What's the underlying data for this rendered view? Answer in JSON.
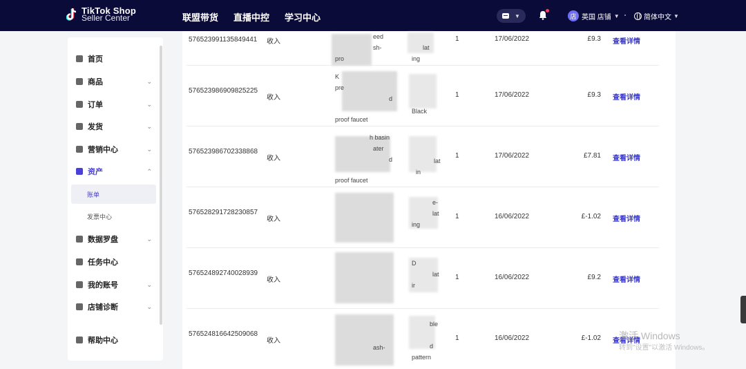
{
  "header": {
    "logo_line1": "TikTok Shop",
    "logo_line2": "Seller Center",
    "nav": [
      "联盟带货",
      "直播中控",
      "学习中心"
    ],
    "account_label": "英国 店铺",
    "account_avatar": "店",
    "language": "简体中文"
  },
  "sidebar": {
    "items": [
      {
        "label": "首页",
        "icon": "home-icon"
      },
      {
        "label": "商品",
        "icon": "product-icon"
      },
      {
        "label": "订单",
        "icon": "order-icon"
      },
      {
        "label": "发货",
        "icon": "truck-icon"
      },
      {
        "label": "营销中心",
        "icon": "megaphone-icon"
      },
      {
        "label": "资产",
        "icon": "wallet-icon"
      },
      {
        "label": "数据罗盘",
        "icon": "chart-icon"
      },
      {
        "label": "任务中心",
        "icon": "medal-icon"
      },
      {
        "label": "我的账号",
        "icon": "user-icon"
      },
      {
        "label": "店铺诊断",
        "icon": "trophy-icon"
      },
      {
        "label": "帮助中心",
        "icon": "help-icon"
      }
    ],
    "sub_items": [
      "账单",
      "发票中心"
    ]
  },
  "table": {
    "rows": [
      {
        "id": "57652399113584944 1",
        "id_display": "57652399113584944​1",
        "type": "收入",
        "product": [
          "eed",
          "sh-",
          "pro"
        ],
        "variant": [
          "lat",
          "ing"
        ],
        "qty": "1",
        "date": "17/06/2022",
        "amount": "£9.3",
        "action": "查看详情"
      },
      {
        "id": "576523986909825225",
        "type": "收入",
        "product": [
          "K",
          "pre",
          "d",
          "proof faucet"
        ],
        "variant": [
          "Black"
        ],
        "qty": "1",
        "date": "17/06/2022",
        "amount": "£9.3",
        "action": "查看详情"
      },
      {
        "id": "576523986702338868",
        "type": "收入",
        "product": [
          "h basin",
          "ater",
          "d",
          "proof faucet"
        ],
        "variant": [
          "lat",
          "in"
        ],
        "qty": "1",
        "date": "17/06/2022",
        "amount": "£7.81",
        "action": "查看详情"
      },
      {
        "id": "576528291728230857",
        "type": "收入",
        "product": [],
        "variant": [
          "e-",
          "lat",
          "ing"
        ],
        "qty": "1",
        "date": "16/06/2022",
        "amount": "£-1.02",
        "action": "查看详情"
      },
      {
        "id": "576524892740028939",
        "type": "收入",
        "product": [],
        "variant": [
          "D",
          "lat",
          "ir"
        ],
        "qty": "1",
        "date": "16/06/2022",
        "amount": "£9.2",
        "action": "查看详情"
      },
      {
        "id": "576524816642509068",
        "type": "收入",
        "product": [
          "ash-"
        ],
        "variant": [
          "ble",
          "d",
          "pattern"
        ],
        "qty": "1",
        "date": "16/06/2022",
        "amount": "£-1.02",
        "action": "查看详情"
      }
    ]
  },
  "watermark": {
    "line1": "激活 Windows",
    "line2": "转到\"设置\"以激活 Windows。"
  }
}
